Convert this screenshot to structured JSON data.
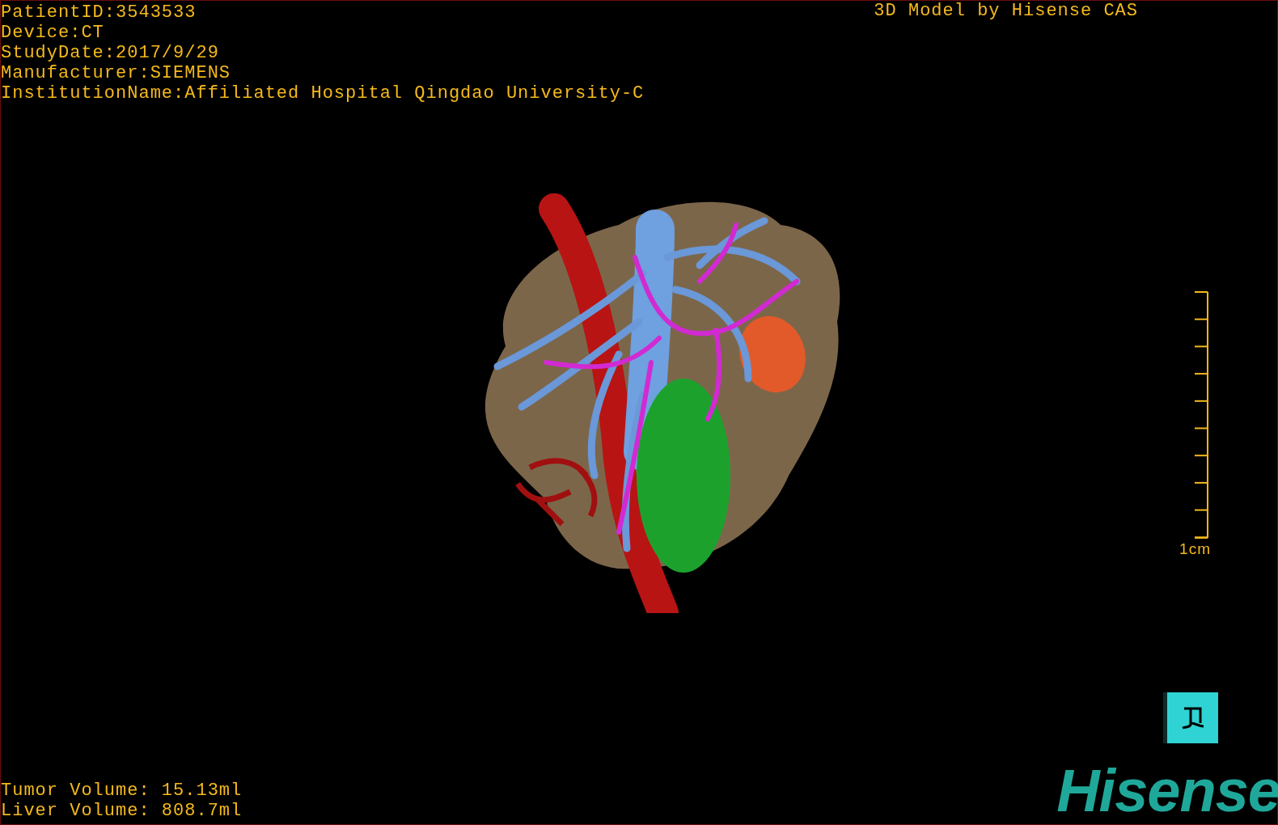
{
  "info": [
    "PatientID:3543533",
    "Device:CT",
    "StudyDate:2017/9/29",
    "Manufacturer:SIEMENS",
    "InstitutionName:Affiliated Hospital Qingdao University-C"
  ],
  "title": "3D Model by Hisense CAS",
  "scale_bar": {
    "label": "1cm"
  },
  "volumes": [
    "Tumor Volume: 15.13ml",
    "Liver Volume: 808.7ml"
  ],
  "logo": "Hisense"
}
